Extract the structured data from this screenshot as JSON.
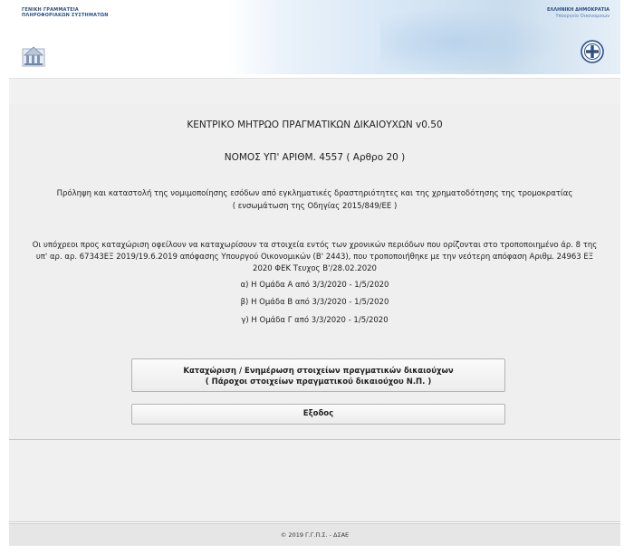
{
  "header": {
    "left_org": "ΓΕΝΙΚΗ ΓΡΑΜΜΑΤΕΙΑ\nΠΛΗΡΟΦΟΡΙΑΚΩΝ ΣΥΣΤΗΜΑΤΩΝ",
    "right_org": "ΕΛΛΗΝΙΚΗ ΔΗΜΟΚΡΑΤΙΑ",
    "right_sub": "Υπουργείο Οικονομικών"
  },
  "main": {
    "app_title": "ΚΕΝΤΡΙΚΟ ΜΗΤΡΩΟ ΠΡΑΓΜΑΤΙΚΩΝ ΔΙΚΑΙΟΥΧΩΝ v0.50",
    "law": "ΝΟΜΟΣ ΥΠ' ΑΡΙΘΜ. 4557 ( Αρθρο 20 )",
    "desc_line1": "Πρόληψη και καταστολή της νομιμοποίησης εσόδων από εγκληματικές δραστηριότητες και της χρηματοδότησης της τρομοκρατίας",
    "desc_line2": "( ενσωμάτωση της Οδηγίας 2015/849/ΕΕ )",
    "obligation_line1": "Οι υπόχρεοι προς καταχώριση οφείλουν να καταχωρίσουν τα στοιχεία εντός των χρονικών περιόδων που ορίζονται στο τροποποιημένο άρ. 8 της",
    "obligation_line2": "υπ' αρ. αρ. 67343ΕΞ 2019/19.6.2019 απόφασης Υπουργού Οικονομικών (Β' 2443), που τροποποιήθηκε με την νεότερη απόφαση Αριθμ. 24963 ΕΞ",
    "obligation_line3": "2020 ΦΕΚ Τευχος Β'/28.02.2020",
    "group_a": "α) Η Ομάδα Α από 3/3/2020 - 1/5/2020",
    "group_b": "β) Η Ομάδα Β από 3/3/2020 - 1/5/2020",
    "group_c": "γ) Η Ομάδα Γ από 3/3/2020 - 1/5/2020",
    "register_line1": "Καταχώριση / Ενημέρωση στοιχείων πραγματικών δικαιούχων",
    "register_line2": "( Πάροχοι στοιχείων πραγματικού δικαιούχου Ν.Π. )",
    "exit_label": "Εξοδος"
  },
  "footer": {
    "copyright": "© 2019 Γ.Γ.Π.Σ. - ΔΣΑΕ"
  },
  "colors": {
    "header_text": "#2c4f86",
    "panel_bg": "#efefef",
    "button_border": "#b3b3b3"
  }
}
